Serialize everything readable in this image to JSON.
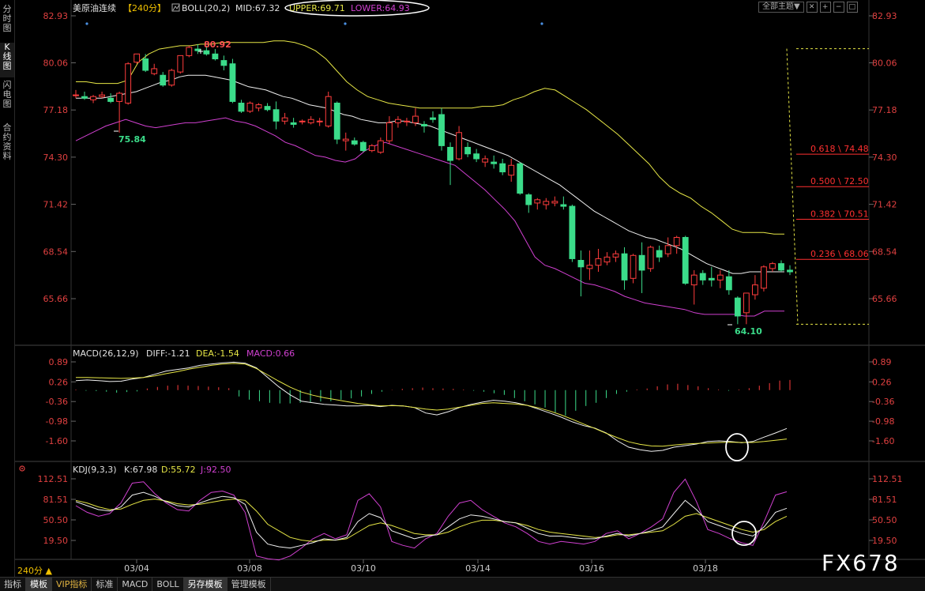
{
  "sidebar": {
    "tabs": [
      "分时图",
      "K线图",
      "闪电图",
      "合约资料"
    ]
  },
  "top_controls": {
    "theme": "全部主题▼"
  },
  "main_legend": {
    "symbol": "美原油连续",
    "period_tag": "【240分】",
    "boll": "BOLL(20,2)",
    "mid": "MID:67.32",
    "upper": "UPPER:69.71",
    "lower": "LOWER:64.93"
  },
  "macd_legend": {
    "title": "MACD(26,12,9)",
    "diff": "DIFF:-1.21",
    "dea": "DEA:-1.54",
    "macd": "MACD:0.66"
  },
  "kdj_legend": {
    "title": "KDJ(9,3,3)",
    "k": "K:67.98",
    "d": "D:55.72",
    "j": "J:92.50"
  },
  "bottom": {
    "period": "240分 ▲",
    "tabs": [
      "指标",
      "模板",
      "VIP指标",
      "标准",
      "MACD",
      "BOLL",
      "另存模板",
      "管理模板"
    ]
  },
  "watermark": "FX678",
  "colors": {
    "up": "#ff3d3d",
    "down": "#3bdc8a",
    "mid": "#f0f0f0",
    "upper": "#e6e646",
    "lower": "#d040d0",
    "fib": "#ff3030",
    "dea": "#e6e646"
  },
  "chart_data": [
    {
      "type": "candlestick",
      "name": "price",
      "y_ticks": [
        82.93,
        80.06,
        77.18,
        74.3,
        71.42,
        68.54,
        65.66
      ],
      "x_ticks": [
        "03/04",
        "03/08",
        "03/10",
        "03/14",
        "03/16",
        "03/18"
      ],
      "ohlc": [
        [
          78.1,
          78.4,
          77.9,
          78.1
        ],
        [
          78.0,
          78.3,
          77.8,
          77.9
        ],
        [
          77.8,
          78.1,
          77.6,
          78.0
        ],
        [
          78.0,
          78.3,
          77.9,
          78.1
        ],
        [
          77.9,
          78.2,
          77.6,
          77.7
        ],
        [
          77.7,
          78.3,
          75.8,
          78.2
        ],
        [
          77.6,
          80.1,
          77.5,
          80.0
        ],
        [
          80.1,
          80.6,
          80.0,
          80.6
        ],
        [
          80.3,
          80.6,
          79.5,
          79.6
        ],
        [
          79.4,
          80.0,
          79.3,
          79.7
        ],
        [
          79.3,
          79.5,
          78.6,
          78.7
        ],
        [
          78.7,
          79.7,
          78.6,
          79.6
        ],
        [
          79.5,
          80.5,
          79.4,
          80.5
        ],
        [
          80.5,
          81.1,
          80.4,
          81.0
        ],
        [
          80.9,
          81.2,
          80.6,
          80.8
        ],
        [
          80.8,
          81.1,
          80.5,
          80.6
        ],
        [
          80.6,
          80.9,
          80.2,
          80.3
        ],
        [
          80.2,
          80.5,
          79.6,
          79.9
        ],
        [
          80.0,
          80.3,
          77.6,
          77.7
        ],
        [
          77.6,
          77.8,
          77.0,
          77.1
        ],
        [
          77.1,
          77.7,
          77.0,
          77.6
        ],
        [
          77.3,
          77.6,
          77.1,
          77.5
        ],
        [
          77.4,
          77.6,
          77.1,
          77.2
        ],
        [
          77.2,
          77.7,
          76.0,
          76.5
        ],
        [
          76.5,
          77.0,
          76.3,
          76.7
        ],
        [
          76.4,
          76.7,
          76.1,
          76.3
        ],
        [
          76.5,
          76.6,
          76.3,
          76.5
        ],
        [
          76.4,
          76.8,
          76.3,
          76.6
        ],
        [
          76.5,
          76.7,
          76.2,
          76.5
        ],
        [
          76.2,
          78.3,
          76.1,
          78.0
        ],
        [
          77.6,
          77.7,
          75.1,
          75.4
        ],
        [
          75.3,
          75.8,
          74.7,
          75.4
        ],
        [
          75.3,
          75.5,
          75.0,
          75.1
        ],
        [
          75.2,
          75.3,
          74.6,
          74.7
        ],
        [
          74.7,
          75.1,
          74.6,
          75.0
        ],
        [
          74.6,
          75.5,
          74.5,
          75.3
        ],
        [
          75.3,
          76.8,
          75.1,
          76.4
        ],
        [
          76.4,
          76.8,
          76.1,
          76.6
        ],
        [
          76.5,
          76.7,
          76.2,
          76.5
        ],
        [
          76.4,
          77.3,
          76.2,
          76.8
        ],
        [
          76.3,
          76.5,
          75.8,
          76.2
        ],
        [
          76.7,
          77.1,
          76.4,
          76.6
        ],
        [
          76.9,
          77.3,
          74.7,
          75.0
        ],
        [
          74.9,
          75.2,
          72.6,
          74.1
        ],
        [
          74.2,
          76.2,
          74.1,
          75.8
        ],
        [
          74.9,
          75.2,
          74.3,
          74.5
        ],
        [
          74.5,
          74.8,
          74.0,
          74.2
        ],
        [
          74.0,
          74.4,
          73.7,
          74.2
        ],
        [
          74.0,
          74.4,
          73.6,
          73.9
        ],
        [
          73.9,
          74.2,
          73.2,
          73.4
        ],
        [
          73.2,
          74.2,
          72.8,
          73.8
        ],
        [
          73.9,
          74.0,
          72.0,
          72.1
        ],
        [
          72.0,
          72.1,
          70.9,
          71.4
        ],
        [
          71.5,
          71.8,
          71.1,
          71.7
        ],
        [
          71.4,
          71.8,
          71.1,
          71.6
        ],
        [
          71.5,
          71.9,
          71.3,
          71.6
        ],
        [
          71.4,
          71.9,
          71.1,
          71.3
        ],
        [
          71.3,
          71.4,
          67.9,
          68.1
        ],
        [
          68.0,
          68.6,
          65.8,
          67.6
        ],
        [
          67.5,
          68.6,
          66.8,
          67.7
        ],
        [
          67.7,
          68.7,
          67.3,
          68.1
        ],
        [
          67.9,
          68.5,
          67.7,
          68.2
        ],
        [
          68.2,
          68.6,
          67.9,
          68.4
        ],
        [
          68.4,
          68.8,
          66.2,
          66.8
        ],
        [
          66.9,
          68.4,
          66.6,
          68.3
        ],
        [
          68.3,
          69.1,
          66.0,
          67.4
        ],
        [
          67.5,
          68.9,
          67.3,
          68.8
        ],
        [
          68.6,
          68.9,
          67.9,
          68.2
        ],
        [
          68.4,
          69.4,
          68.2,
          68.9
        ],
        [
          68.9,
          69.5,
          68.4,
          69.4
        ],
        [
          69.4,
          69.5,
          66.5,
          66.6
        ],
        [
          66.5,
          67.4,
          65.3,
          67.1
        ],
        [
          67.2,
          67.4,
          66.5,
          66.8
        ],
        [
          66.9,
          67.6,
          66.4,
          66.8
        ],
        [
          66.8,
          67.4,
          66.3,
          67.1
        ],
        [
          67.0,
          67.4,
          65.9,
          66.2
        ],
        [
          65.7,
          65.8,
          64.1,
          64.6
        ],
        [
          64.8,
          66.0,
          64.1,
          66.0
        ],
        [
          65.9,
          67.1,
          65.6,
          66.5
        ],
        [
          66.3,
          67.7,
          66.1,
          67.6
        ],
        [
          67.5,
          67.9,
          67.3,
          67.8
        ],
        [
          67.8,
          68.0,
          67.3,
          67.4
        ],
        [
          67.4,
          67.7,
          67.1,
          67.3
        ]
      ],
      "mid": [
        77.9,
        77.9,
        77.9,
        77.9,
        78.0,
        78.1,
        78.2,
        78.3,
        78.5,
        78.7,
        78.9,
        79.0,
        79.2,
        79.3,
        79.3,
        79.3,
        79.2,
        79.1,
        79.0,
        78.8,
        78.6,
        78.5,
        78.4,
        78.2,
        78.0,
        77.9,
        77.7,
        77.5,
        77.4,
        77.3,
        77.1,
        76.9,
        76.8,
        76.6,
        76.5,
        76.4,
        76.4,
        76.5,
        76.5,
        76.4,
        76.3,
        76.2,
        76.0,
        75.8,
        75.6,
        75.4,
        75.2,
        75.0,
        74.8,
        74.6,
        74.4,
        74.1,
        73.8,
        73.5,
        73.2,
        72.9,
        72.6,
        72.2,
        71.8,
        71.4,
        71.0,
        70.7,
        70.4,
        70.1,
        69.8,
        69.6,
        69.4,
        69.3,
        69.1,
        68.9,
        68.7,
        68.4,
        68.1,
        67.8,
        67.6,
        67.4,
        67.2,
        67.2,
        67.3,
        67.3,
        67.3,
        67.3,
        67.3
      ],
      "upper": [
        78.9,
        78.9,
        78.8,
        78.8,
        78.8,
        79.0,
        80.1,
        80.6,
        80.9,
        81.0,
        81.1,
        81.1,
        81.2,
        81.2,
        81.3,
        81.3,
        81.3,
        81.3,
        81.3,
        81.4,
        81.4,
        81.3,
        81.1,
        80.8,
        80.3,
        79.6,
        78.9,
        78.4,
        78.0,
        77.8,
        77.6,
        77.5,
        77.4,
        77.3,
        77.3,
        77.3,
        77.3,
        77.3,
        77.3,
        77.4,
        77.4,
        77.5,
        77.8,
        78.0,
        78.3,
        78.5,
        78.4,
        78.0,
        77.6,
        77.2,
        76.7,
        76.2,
        75.7,
        75.1,
        74.5,
        73.9,
        73.1,
        72.5,
        72.1,
        71.8,
        71.3,
        70.9,
        70.4,
        69.9,
        69.7,
        69.7,
        69.7,
        69.6,
        69.6
      ],
      "lower": [
        75.3,
        75.6,
        75.9,
        76.2,
        76.4,
        76.6,
        76.4,
        76.2,
        76.1,
        76.2,
        76.3,
        76.4,
        76.4,
        76.5,
        76.6,
        76.7,
        76.5,
        76.4,
        76.2,
        75.9,
        75.6,
        75.2,
        75.0,
        74.7,
        74.4,
        74.3,
        74.1,
        74.0,
        74.2,
        74.7,
        75.0,
        75.2,
        75.0,
        74.8,
        74.6,
        74.4,
        74.2,
        74.0,
        73.8,
        73.3,
        72.8,
        72.3,
        71.7,
        71.1,
        70.4,
        69.3,
        68.2,
        67.7,
        67.5,
        67.2,
        66.9,
        66.6,
        66.5,
        66.3,
        66.1,
        65.8,
        65.6,
        65.4,
        65.3,
        65.2,
        65.1,
        65.0,
        64.8,
        64.7,
        64.7,
        64.7,
        64.7,
        64.6,
        64.6,
        64.9,
        64.9,
        64.9
      ],
      "annotations": [
        {
          "label": "80.92",
          "value": 80.92
        },
        {
          "label": "75.84",
          "value": 75.84
        },
        {
          "label": "64.10",
          "value": 64.1
        }
      ],
      "fib_levels": [
        {
          "label": "0.618 \\ 74.48",
          "value": 74.48
        },
        {
          "label": "0.500 \\ 72.50",
          "value": 72.5
        },
        {
          "label": "0.382 \\ 70.51",
          "value": 70.51
        },
        {
          "label": "0.236 \\ 68.06",
          "value": 68.06
        }
      ],
      "fib_range": [
        64.1,
        80.92
      ]
    },
    {
      "type": "macd",
      "name": "macd",
      "y_ticks": [
        0.89,
        0.26,
        -0.36,
        -0.98,
        -1.6
      ],
      "ylim": [
        -1.96,
        1.12
      ],
      "diff": [
        0.3,
        0.32,
        0.3,
        0.27,
        0.28,
        0.35,
        0.4,
        0.5,
        0.6,
        0.65,
        0.7,
        0.78,
        0.82,
        0.86,
        0.88,
        0.85,
        0.7,
        0.4,
        0.1,
        -0.15,
        -0.35,
        -0.4,
        -0.45,
        -0.47,
        -0.5,
        -0.5,
        -0.48,
        -0.52,
        -0.48,
        -0.5,
        -0.55,
        -0.72,
        -0.78,
        -0.68,
        -0.55,
        -0.45,
        -0.38,
        -0.32,
        -0.35,
        -0.4,
        -0.48,
        -0.6,
        -0.72,
        -0.85,
        -1.0,
        -1.12,
        -1.2,
        -1.35,
        -1.6,
        -1.8,
        -1.88,
        -1.93,
        -1.9,
        -1.8,
        -1.75,
        -1.7,
        -1.62,
        -1.6,
        -1.62,
        -1.66,
        -1.62,
        -1.48,
        -1.35,
        -1.21
      ],
      "dea": [
        0.4,
        0.4,
        0.39,
        0.38,
        0.37,
        0.38,
        0.4,
        0.45,
        0.52,
        0.58,
        0.66,
        0.72,
        0.78,
        0.82,
        0.84,
        0.82,
        0.68,
        0.48,
        0.28,
        0.09,
        -0.06,
        -0.16,
        -0.24,
        -0.3,
        -0.36,
        -0.42,
        -0.46,
        -0.5,
        -0.49,
        -0.5,
        -0.55,
        -0.6,
        -0.63,
        -0.6,
        -0.54,
        -0.48,
        -0.42,
        -0.4,
        -0.42,
        -0.44,
        -0.48,
        -0.56,
        -0.66,
        -0.78,
        -0.92,
        -1.07,
        -1.21,
        -1.36,
        -1.5,
        -1.63,
        -1.71,
        -1.76,
        -1.77,
        -1.73,
        -1.7,
        -1.68,
        -1.67,
        -1.65,
        -1.64,
        -1.65,
        -1.65,
        -1.62,
        -1.58,
        -1.54
      ],
      "hist": [
        0.02,
        -0.02,
        -0.03,
        -0.05,
        -0.08,
        -0.06,
        -0.04,
        0.05,
        0.1,
        0.14,
        0.16,
        0.14,
        0.13,
        0.11,
        0.09,
        0.06,
        -0.2,
        -0.3,
        -0.35,
        -0.4,
        -0.42,
        -0.42,
        -0.4,
        -0.38,
        -0.36,
        -0.35,
        -0.3,
        -0.26,
        -0.2,
        -0.12,
        -0.05,
        0.01,
        0.04,
        0.06,
        0.08,
        0.06,
        0.05,
        0.04,
        0.02,
        -0.02,
        -0.05,
        -0.1,
        -0.15,
        -0.25,
        -0.35,
        -0.45,
        -0.55,
        -0.7,
        -0.8,
        -0.65,
        -0.5,
        -0.4,
        -0.25,
        -0.12,
        -0.05,
        0.02,
        0.05,
        0.12,
        0.18,
        0.2,
        0.16,
        0.12,
        0.06,
        0.02,
        -0.02,
        0.02,
        0.06,
        0.14,
        0.22,
        0.3,
        0.32
      ]
    },
    {
      "type": "kdj",
      "name": "kdj",
      "y_ticks": [
        112.51,
        81.51,
        50.5,
        19.5
      ],
      "ylim": [
        5,
        120
      ],
      "k": [
        78,
        72,
        66,
        64,
        70,
        88,
        92,
        86,
        78,
        72,
        70,
        76,
        82,
        86,
        84,
        74,
        32,
        14,
        10,
        8,
        12,
        16,
        22,
        20,
        24,
        48,
        60,
        54,
        34,
        28,
        22,
        26,
        28,
        40,
        52,
        58,
        56,
        52,
        48,
        46,
        38,
        30,
        26,
        26,
        24,
        22,
        22,
        26,
        30,
        26,
        30,
        34,
        40,
        60,
        80,
        66,
        48,
        42,
        36,
        30,
        26,
        40,
        62,
        68
      ],
      "d": [
        80,
        76,
        70,
        66,
        67,
        74,
        80,
        82,
        79,
        75,
        73,
        74,
        77,
        80,
        82,
        80,
        64,
        44,
        34,
        24,
        20,
        18,
        20,
        20,
        22,
        32,
        42,
        46,
        42,
        36,
        30,
        28,
        28,
        32,
        40,
        46,
        50,
        50,
        48,
        46,
        42,
        36,
        32,
        30,
        28,
        26,
        24,
        25,
        28,
        28,
        30,
        32,
        34,
        44,
        56,
        60,
        54,
        48,
        42,
        36,
        32,
        36,
        48,
        56
      ],
      "j": [
        72,
        62,
        56,
        60,
        76,
        106,
        108,
        90,
        76,
        66,
        64,
        80,
        92,
        94,
        88,
        62,
        -4,
        -8,
        -10,
        -4,
        8,
        22,
        30,
        22,
        28,
        80,
        90,
        70,
        18,
        12,
        8,
        22,
        30,
        56,
        76,
        80,
        66,
        56,
        46,
        40,
        30,
        18,
        14,
        18,
        16,
        14,
        18,
        30,
        34,
        22,
        30,
        40,
        52,
        92,
        112,
        78,
        36,
        30,
        22,
        16,
        12,
        48,
        88,
        93
      ]
    }
  ]
}
